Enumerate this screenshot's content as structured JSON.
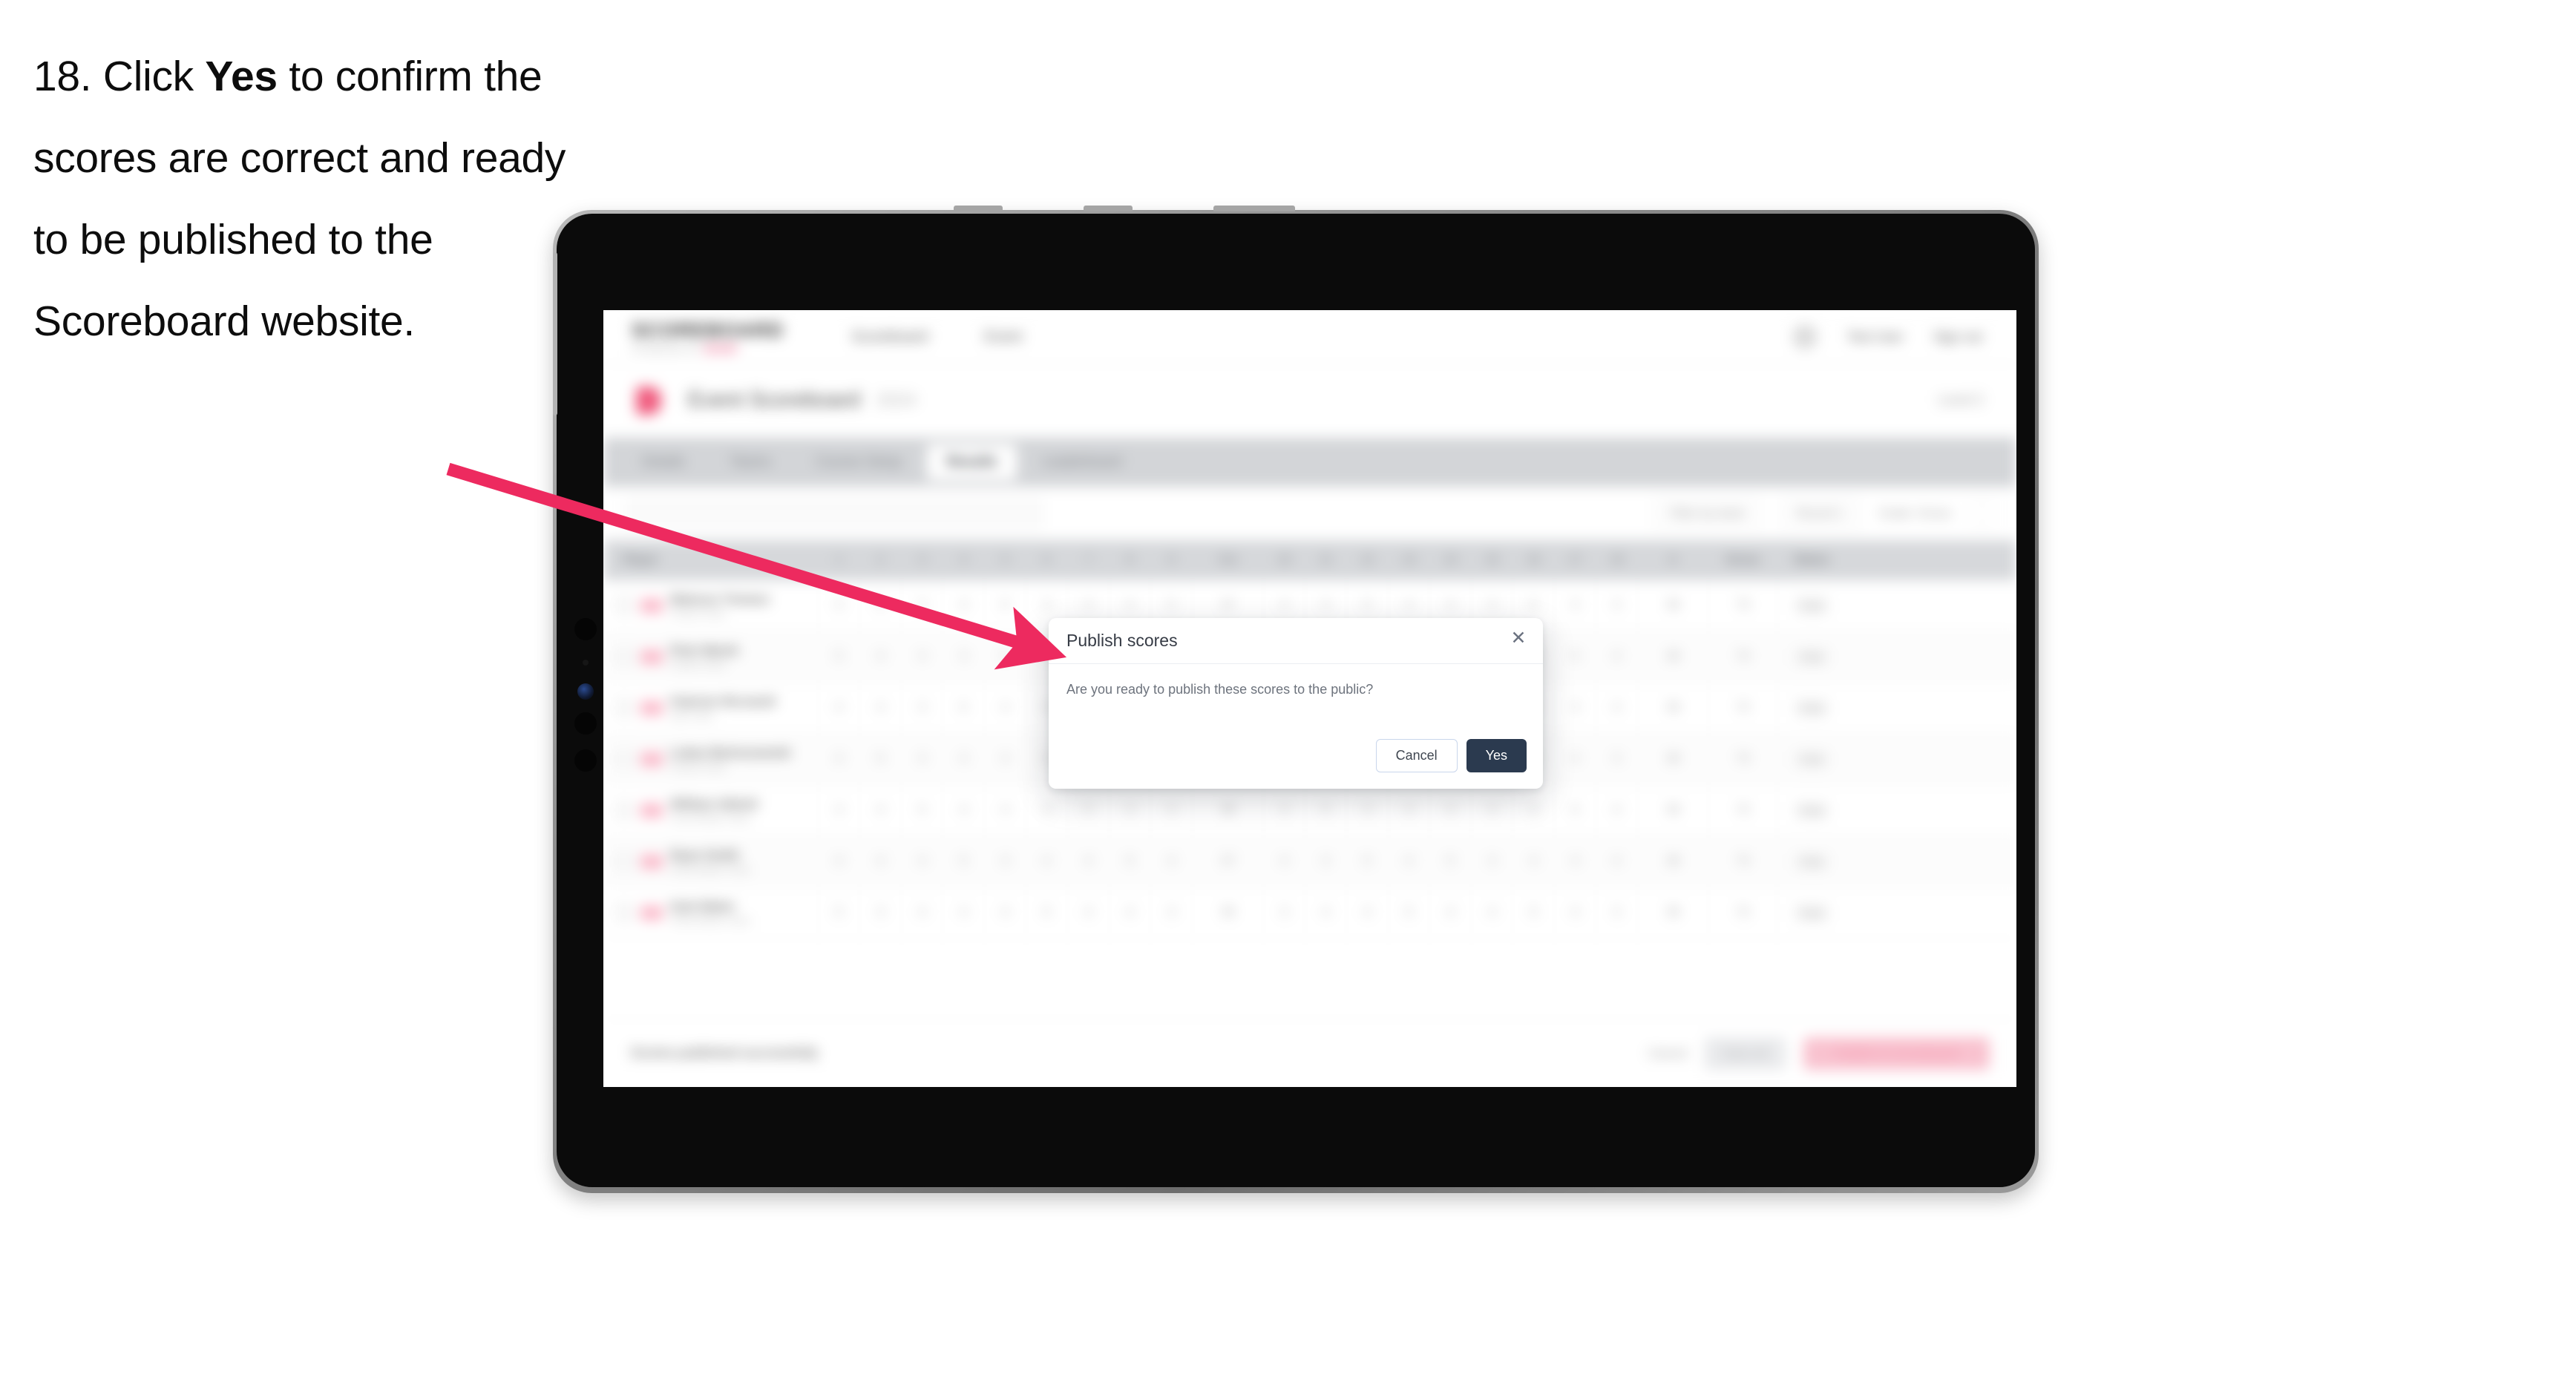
{
  "instruction": {
    "number": "18.",
    "text_before": " Click ",
    "emphasis": "Yes",
    "text_after": " to confirm the scores are correct and ready to be published to the Scoreboard website."
  },
  "device": {
    "kind": "tablet",
    "orientation": "landscape"
  },
  "app": {
    "topnav": {
      "brand": "SCOREBOARD",
      "brand_sub": "POWERED BY",
      "brand_sub_accent": "SPORT",
      "links": [
        "Scoreboard",
        "Event"
      ],
      "right_links": [
        "Test User",
        "Sign out"
      ],
      "avatar_icon": "user-avatar-icon"
    },
    "page_head": {
      "icon": "event-flag-icon",
      "title": "Event Scoreboard",
      "badge": "2024",
      "right_label": "Level 2"
    },
    "tabs": [
      {
        "label": "Details",
        "active": false
      },
      {
        "label": "Teams",
        "active": false
      },
      {
        "label": "Course Setup",
        "active": false
      },
      {
        "label": "Results",
        "active": true
      },
      {
        "label": "Leaderboard",
        "active": false
      }
    ],
    "filterbar": {
      "search_placeholder": "Search",
      "controls": [
        "Filter by team",
        "Round 1",
        "Scale: Gross"
      ],
      "expand_icon": "expand-icon"
    },
    "table": {
      "columns": [
        {
          "label": "Player",
          "type": "player"
        },
        {
          "label": "1",
          "type": "num"
        },
        {
          "label": "2",
          "type": "num"
        },
        {
          "label": "3",
          "type": "num"
        },
        {
          "label": "4",
          "type": "num"
        },
        {
          "label": "5",
          "type": "num"
        },
        {
          "label": "6",
          "type": "num"
        },
        {
          "label": "7",
          "type": "num"
        },
        {
          "label": "8",
          "type": "num"
        },
        {
          "label": "9",
          "type": "num"
        },
        {
          "label": "Out",
          "type": "wide"
        },
        {
          "label": "10",
          "type": "num"
        },
        {
          "label": "11",
          "type": "num"
        },
        {
          "label": "12",
          "type": "num"
        },
        {
          "label": "13",
          "type": "num"
        },
        {
          "label": "14",
          "type": "num"
        },
        {
          "label": "15",
          "type": "num"
        },
        {
          "label": "16",
          "type": "num"
        },
        {
          "label": "17",
          "type": "num"
        },
        {
          "label": "18",
          "type": "num"
        },
        {
          "label": "In",
          "type": "wide"
        },
        {
          "label": "Gross",
          "type": "tot"
        },
        {
          "label": "Status",
          "type": "tot"
        }
      ],
      "rows": [
        {
          "flag_icon": "country-flag-icon",
          "name": "Mateusz Tomasz",
          "team": "Poland Team",
          "scores": [
            "4",
            "5",
            "3",
            "4",
            "5",
            "4",
            "3",
            "4",
            "5",
            "37",
            "4",
            "3",
            "5",
            "4",
            "4",
            "3",
            "5",
            "4",
            "4",
            "36",
            "73"
          ],
          "status": "Final"
        },
        {
          "flag_icon": "country-flag-icon",
          "name": "Piotr Marek",
          "team": "Poland Team",
          "scores": [
            "5",
            "4",
            "4",
            "3",
            "5",
            "4",
            "4",
            "5",
            "4",
            "38",
            "3",
            "4",
            "4",
            "5",
            "3",
            "4",
            "4",
            "5",
            "4",
            "36",
            "74"
          ],
          "status": "Final"
        },
        {
          "flag_icon": "country-flag-icon",
          "name": "Fabrizio Ricciardi",
          "team": "Italy Team",
          "scores": [
            "4",
            "4",
            "3",
            "5",
            "4",
            "5",
            "3",
            "4",
            "4",
            "36",
            "4",
            "4",
            "3",
            "5",
            "4",
            "4",
            "5",
            "3",
            "4",
            "36",
            "72"
          ],
          "status": "Final"
        },
        {
          "flag_icon": "country-flag-icon",
          "name": "Lukas Bartoszewski",
          "team": "Poland Team",
          "scores": [
            "4",
            "5",
            "4",
            "4",
            "3",
            "5",
            "4",
            "3",
            "5",
            "37",
            "5",
            "4",
            "4",
            "3",
            "4",
            "5",
            "4",
            "4",
            "3",
            "36",
            "73"
          ],
          "status": "Final"
        },
        {
          "flag_icon": "country-flag-icon",
          "name": "William Abbott",
          "team": "Great Britain Team",
          "scores": [
            "3",
            "4",
            "5",
            "4",
            "4",
            "4",
            "5",
            "3",
            "4",
            "36",
            "4",
            "5",
            "3",
            "4",
            "4",
            "4",
            "3",
            "5",
            "4",
            "36",
            "72"
          ],
          "status": "Final"
        },
        {
          "flag_icon": "country-flag-icon",
          "name": "Ryan Smith",
          "team": "Great Britain Team",
          "scores": [
            "4",
            "4",
            "4",
            "5",
            "3",
            "4",
            "4",
            "5",
            "4",
            "37",
            "4",
            "3",
            "5",
            "4",
            "5",
            "3",
            "4",
            "4",
            "4",
            "36",
            "73"
          ],
          "status": "Final"
        },
        {
          "flag_icon": "country-flag-icon",
          "name": "Kyle Baker",
          "team": "Great Britain Team",
          "scores": [
            "5",
            "3",
            "4",
            "4",
            "4",
            "5",
            "4",
            "4",
            "3",
            "36",
            "3",
            "4",
            "4",
            "5",
            "4",
            "4",
            "5",
            "4",
            "3",
            "36",
            "72"
          ],
          "status": "Final"
        }
      ]
    },
    "footer": {
      "note": "Scores published successfully",
      "cancel_label": "Cancel",
      "secondary_label": "Save all",
      "primary_label": "Publish to Scoreboard"
    }
  },
  "modal": {
    "title": "Publish scores",
    "close_icon": "close-icon",
    "body": "Are you ready to publish these scores to the public?",
    "cancel_label": "Cancel",
    "confirm_label": "Yes"
  },
  "annotation": {
    "arrow_icon": "callout-arrow-icon",
    "arrow_color": "#ED2A5F"
  },
  "colors": {
    "accent_pink": "#ED2A5F",
    "confirm_button": "#2B3A4F",
    "cancel_border": "#C9D6EC",
    "tabbar_bg": "#D3D5D8",
    "brand_pink": "#E8376B"
  }
}
